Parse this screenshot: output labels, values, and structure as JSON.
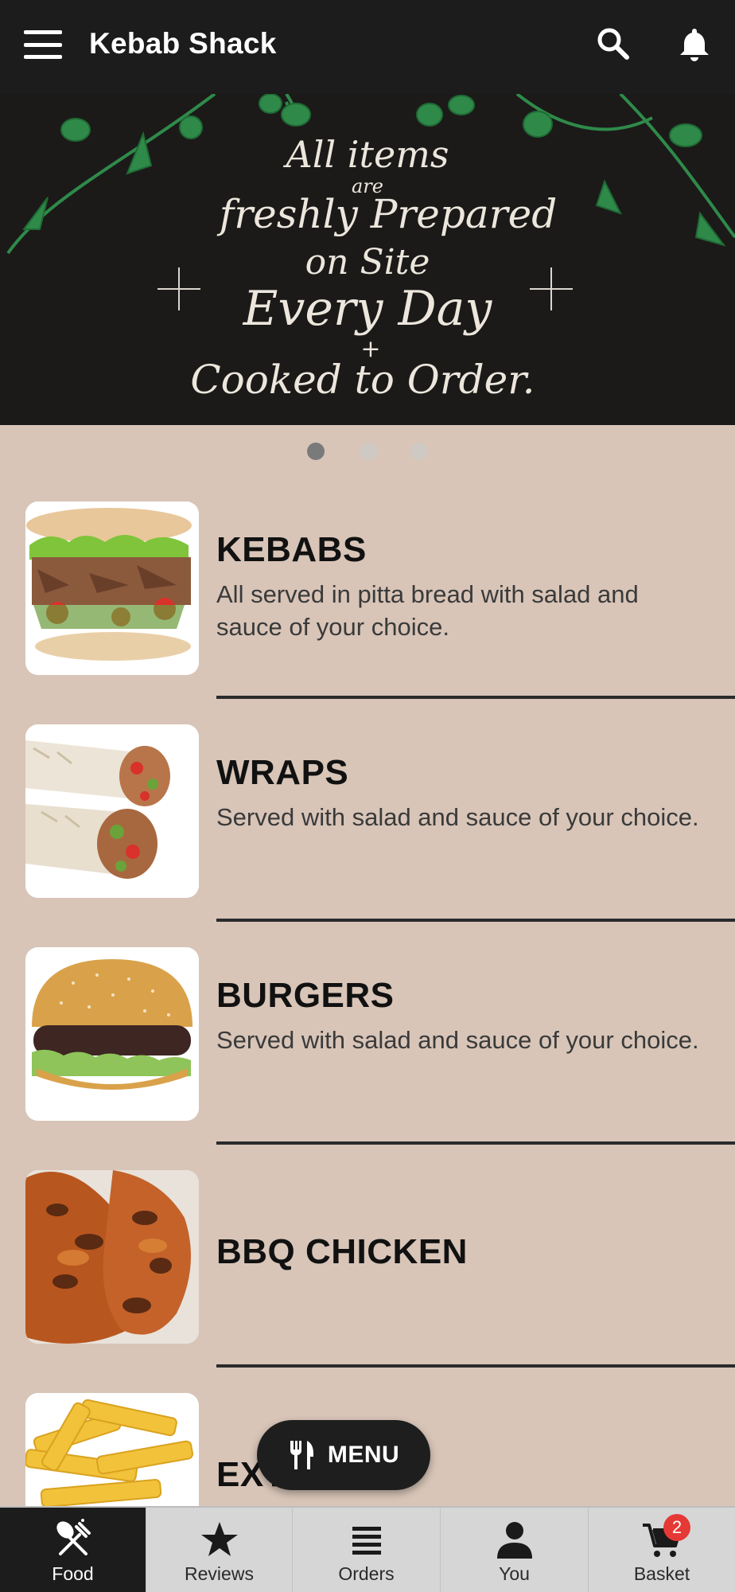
{
  "header": {
    "title": "Kebab Shack"
  },
  "banner": {
    "line1": "All items",
    "line2": "are",
    "line3": "freshly Prepared",
    "line4": "on Site",
    "line5": "Every Day",
    "line6": "+",
    "line7": "Cooked to Order."
  },
  "carousel": {
    "count": 3,
    "active_index": 0
  },
  "categories": [
    {
      "name": "KEBABS",
      "description": "All served in pitta bread with salad and sauce of your choice."
    },
    {
      "name": "WRAPS",
      "description": "Served with salad and sauce of your choice."
    },
    {
      "name": "BURGERS",
      "description": "Served with salad and sauce of your choice."
    },
    {
      "name": "BBQ CHICKEN",
      "description": ""
    },
    {
      "name": "EXTRAS",
      "description": ""
    }
  ],
  "fab": {
    "label": "MENU"
  },
  "bottom_nav": {
    "items": [
      {
        "label": "Food",
        "icon": "fork-knife-icon",
        "active": true
      },
      {
        "label": "Reviews",
        "icon": "star-icon",
        "active": false
      },
      {
        "label": "Orders",
        "icon": "list-icon",
        "active": false
      },
      {
        "label": "You",
        "icon": "person-icon",
        "active": false
      },
      {
        "label": "Basket",
        "icon": "cart-icon",
        "active": false,
        "badge": "2"
      }
    ]
  },
  "colors": {
    "header_bg": "#1c1c1c",
    "page_bg": "#d8c5b8",
    "badge": "#e53935"
  }
}
